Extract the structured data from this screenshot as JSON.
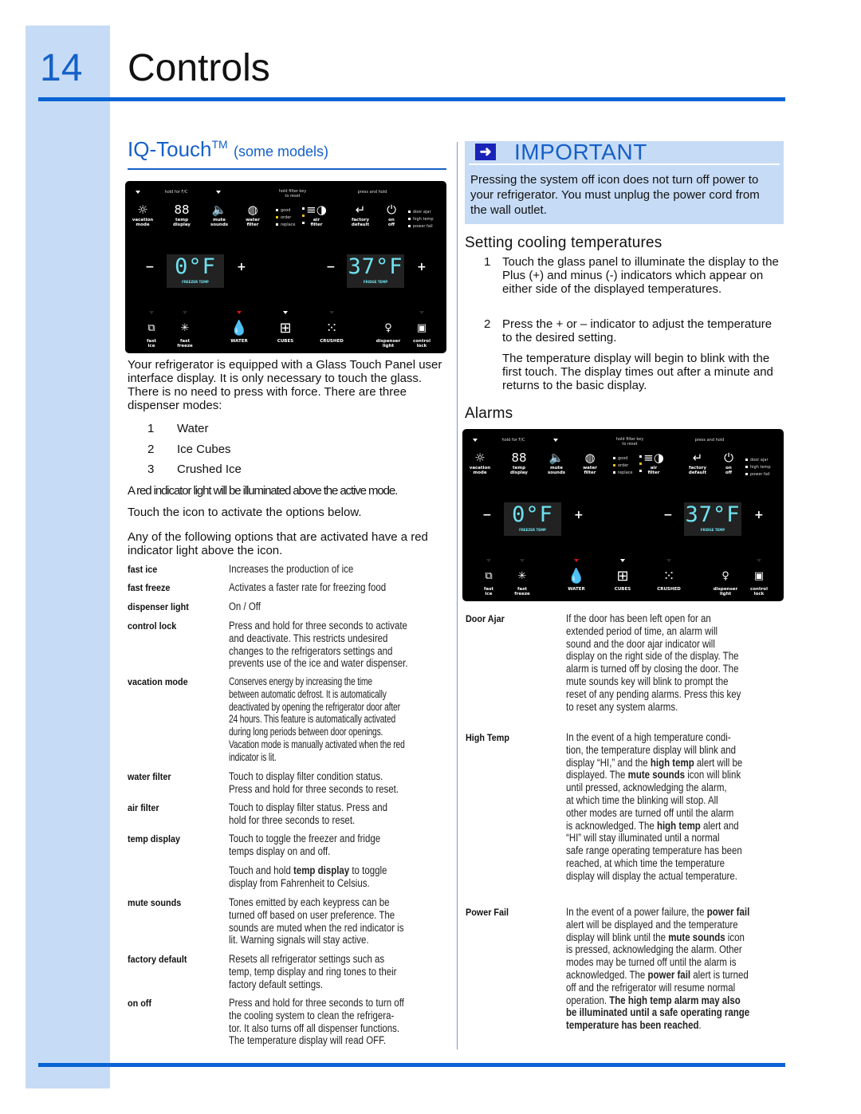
{
  "page": {
    "chapter_number": "14",
    "chapter_title": "Controls"
  },
  "left": {
    "section_title": "IQ-Touch",
    "section_tm": "TM",
    "section_suffix": "(some models)",
    "intro": "Your refrigerator is equipped with a Glass Touch Panel user interface display. It is only necessary to touch the glass. There is no need to press with force. There are three dispenser modes:",
    "modes": [
      {
        "num": "1",
        "label": "Water"
      },
      {
        "num": "2",
        "label": "Ice Cubes"
      },
      {
        "num": "3",
        "label": "Crushed Ice"
      }
    ],
    "red_indicator_note": "A red indicator light will be illuminated above the active mode.",
    "touch_note": "Touch the icon to activate the options below.",
    "options_note": "Any of the following options that are activated have a red indicator light above the icon.",
    "options": [
      {
        "term": "fast ice",
        "desc": "Increases the production of ice"
      },
      {
        "term": "fast freeze",
        "desc": "Activates a faster rate for freezing food"
      },
      {
        "term": "dispenser light",
        "desc": "On / Off"
      },
      {
        "term": "control lock",
        "desc": "Press and hold for three seconds to activate\nand deactivate. This restricts undesired\nchanges to the refrigerators settings and\nprevents use of the ice and water dispenser."
      },
      {
        "term": "vacation mode",
        "desc": "Conserves energy by increasing the time\nbetween automatic defrost. It is automatically\ndeactivated by opening the refrigerator door after\n24 hours. This feature is automatically activated\nduring long periods between door openings.\nVacation mode is manually activated when the red\nindicator is lit."
      },
      {
        "term": "water filter",
        "desc": "Touch to display filter condition status.\nPress and hold for three seconds to reset."
      },
      {
        "term": "air filter",
        "desc": "Touch to display filter status. Press and\nhold for three seconds to reset."
      },
      {
        "term": "temp display",
        "desc": "Touch to toggle the freezer and fridge\ntemps display  on and off."
      },
      {
        "term": "",
        "desc_pre": "Touch and hold ",
        "desc_bold": "temp display",
        "desc_post": " to toggle\ndisplay from Fahrenheit to Celsius."
      },
      {
        "term": "mute sounds",
        "desc": "Tones emitted by each keypress can be\nturned off based on user preference. The\nsounds are muted when the red indicator is\nlit. Warning signals will stay active."
      },
      {
        "term": "factory default",
        "desc": "Resets all refrigerator settings such as\ntemp, temp display and ring tones to their\nfactory default settings."
      },
      {
        "term": "on off",
        "desc": "Press and hold for three seconds to turn off\nthe cooling system  to clean the refrigera-\ntor. It also turns off all dispenser functions.\nThe temperature display will read OFF."
      }
    ]
  },
  "panel": {
    "hints": {
      "hold_fc": "hold for F/C",
      "hold_filter": "hold filter key\nto reset",
      "press_hold": "press and hold"
    },
    "top_buttons": [
      {
        "id": "vacation-mode",
        "icon": "sun-icon",
        "glyph": "☼",
        "label": "vacation\nmode"
      },
      {
        "id": "temp-display",
        "icon": "digits-icon",
        "glyph": "88",
        "label": "temp\ndisplay"
      },
      {
        "id": "mute-sounds",
        "icon": "speaker-icon",
        "glyph": "🔈",
        "label": "mute\nsounds"
      },
      {
        "id": "water-filter",
        "icon": "water-filter-icon",
        "glyph": "◍",
        "label": "water\nfilter"
      },
      {
        "id": "air-filter",
        "icon": "air-filter-icon",
        "glyph": "≡◑",
        "label": "air\nfilter"
      },
      {
        "id": "factory-default",
        "icon": "return-arrow-icon",
        "glyph": "↵",
        "label": "factory\ndefault"
      },
      {
        "id": "on-off",
        "icon": "power-icon",
        "glyph": "⏻",
        "label": "on\noff"
      }
    ],
    "filter_status": [
      "good",
      "order",
      "replace"
    ],
    "alerts": [
      "door ajar",
      "high temp",
      "power fail"
    ],
    "freezer": {
      "value": "0°F",
      "label": "FREEZER TEMP"
    },
    "fridge": {
      "value": "37°F",
      "label": "FRIDGE TEMP"
    },
    "minus": "−",
    "plus": "+",
    "bottom_buttons": [
      {
        "id": "fast-ice",
        "icon": "ice-cubes-stack-icon",
        "glyph": "⧉",
        "label": "fast\nice",
        "indicator": "off"
      },
      {
        "id": "fast-freeze",
        "icon": "snowflake-icon",
        "glyph": "✳",
        "label": "fast\nfreeze",
        "indicator": "off"
      },
      {
        "id": "water",
        "icon": "water-drop-icon",
        "glyph": "💧",
        "label": "WATER",
        "indicator": "red"
      },
      {
        "id": "cubes",
        "icon": "cubes-icon",
        "glyph": "⊞",
        "label": "CUBES",
        "indicator": "white"
      },
      {
        "id": "crushed",
        "icon": "crushed-ice-icon",
        "glyph": "⁙",
        "label": "CRUSHED",
        "indicator": "off"
      },
      {
        "id": "dispenser-light",
        "icon": "light-bulb-icon",
        "glyph": "♀",
        "label": "dispenser\nlight",
        "indicator": "none"
      },
      {
        "id": "control-lock",
        "icon": "lock-icon",
        "glyph": "▣",
        "label": "control\nlock",
        "indicator": "off"
      }
    ]
  },
  "right": {
    "important": {
      "icon": "arrow-right-icon",
      "title": "IMPORTANT",
      "text": "Pressing the system off icon does not turn off power to your refrigerator. You must unplug the power cord from the wall outlet."
    },
    "cooling_title": "Setting cooling temperatures",
    "cooling_steps": [
      {
        "num": "1",
        "text": "Touch the glass panel to illuminate the display to the Plus (+) and minus (-) indicators which appear on either side of the displayed temperatures."
      },
      {
        "num": "2",
        "text": "Press the + or – indicator to adjust the temperature to the desired setting."
      }
    ],
    "cooling_note": "The temperature display will begin to blink with the first touch. The display times out after a minute and returns to the basic display.",
    "alarms_title": "Alarms",
    "alarms": [
      {
        "term": "Door Ajar",
        "html": "If the door has been left open for an\nextended period of time, an alarm will\nsound and the door ajar indicator will\ndisplay on the right side of the display. The\nalarm is turned off by closing the door. The\nmute sounds key will blink to prompt the\nreset of any pending alarms. Press this key\nto reset any system alarms."
      },
      {
        "term": "High Temp",
        "html": "In the event of a high temperature condi-\ntion, the temperature display will blink and\ndisplay “HI,” and the <b>high temp</b> alert will be\ndisplayed. The <b>mute sounds</b> icon will blink\nuntil pressed, acknowledging the alarm,\nat which time the blinking will stop. All\nother modes are turned off until the alarm\nis acknowledged. The <b>high temp</b> alert and\n“HI” will stay illuminated until a normal\nsafe range operating temperature has been\nreached, at which time the temperature\ndisplay will display the actual temperature."
      },
      {
        "term": "Power Fail",
        "html": "In the event of a power failure, the <b>power fail</b>\nalert will be displayed and the temperature\ndisplay will blink until the <b>mute sounds</b> icon\nis pressed, acknowledging the alarm. Other\nmodes may be turned off until the alarm is\nacknowledged. The <b>power fail</b> alert is turned\noff and the refrigerator will resume normal\noperation. <b>The high temp alarm may also\nbe illuminated until a safe operating range\ntemperature has been reached</b>."
      }
    ]
  },
  "colors": {
    "accent_blue": "#1560c8",
    "rule_blue": "#0863d4",
    "band_light_blue": "#c6dbf5",
    "display_cyan": "#6fe2f0",
    "indicator_red": "#e01010",
    "filter_yellow": "#f0c000"
  }
}
